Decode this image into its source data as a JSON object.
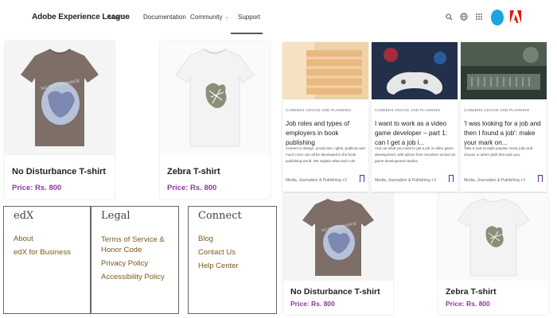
{
  "header": {
    "brand": "Adobe Experience League",
    "nav": [
      {
        "label": "Learn",
        "dropdown": true
      },
      {
        "label": "Documentation",
        "dropdown": false
      },
      {
        "label": "Community",
        "dropdown": true
      },
      {
        "label": "Support",
        "dropdown": false
      }
    ],
    "icons": [
      "search-icon",
      "globe-icon",
      "apps-grid-icon",
      "avatar",
      "adobe-logo"
    ]
  },
  "products": [
    {
      "name": "No Disturbance T-shirt",
      "price": "Price: Rs. 800",
      "shirt_color": "#7d6e68"
    },
    {
      "name": "Zebra T-shirt",
      "price": "Price: Rs. 800",
      "shirt_color": "#f5f5f5"
    },
    {
      "name": "No Disturbance T-shirt",
      "price": "Price: Rs. 800",
      "shirt_color": "#7d6e68"
    },
    {
      "name": "Zebra T-shirt",
      "price": "Price: Rs. 800",
      "shirt_color": "#f5f5f5"
    }
  ],
  "articles": [
    {
      "category": "CAREERS ADVICE AND PLANNING",
      "title": "Job roles and types of employers in book publishing",
      "description": "Careers in design, production, rights, publicity and much more can all be developed in the book publishing world. We explain what each role involves...",
      "meta": "Media, Journalism & Publishing +3"
    },
    {
      "category": "CAREERS ADVICE AND PLANNING",
      "title": "I want to work as a video game developer – part 1: can I get a job i...",
      "description": "And out what you need to get a job in video game development, with advice from recruiters at two UK game development studios.",
      "meta": "Media, Journalism & Publishing +3"
    },
    {
      "category": "CAREERS ADVICE AND PLANNING",
      "title": "'I was looking for a job and then I found a job': make your mark on...",
      "description": "Take a look at eight popular music jobs and choose a career path that suits you.",
      "meta": "Media, Journalism & Publishing +3"
    }
  ],
  "footer": {
    "columns": [
      {
        "heading": "edX",
        "links": [
          "About",
          "edX for Business"
        ]
      },
      {
        "heading": "Legal",
        "links": [
          "Terms of Service & Honor Code",
          "Privacy Policy",
          "Accessibility Policy"
        ]
      },
      {
        "heading": "Connect",
        "links": [
          "Blog",
          "Contact Us",
          "Help Center"
        ]
      }
    ]
  },
  "colors": {
    "price": "#8a3aa0",
    "footer_link": "#7b5a1e",
    "accent_blue": "#1aa4e0",
    "adobe_red": "#eb1000"
  }
}
